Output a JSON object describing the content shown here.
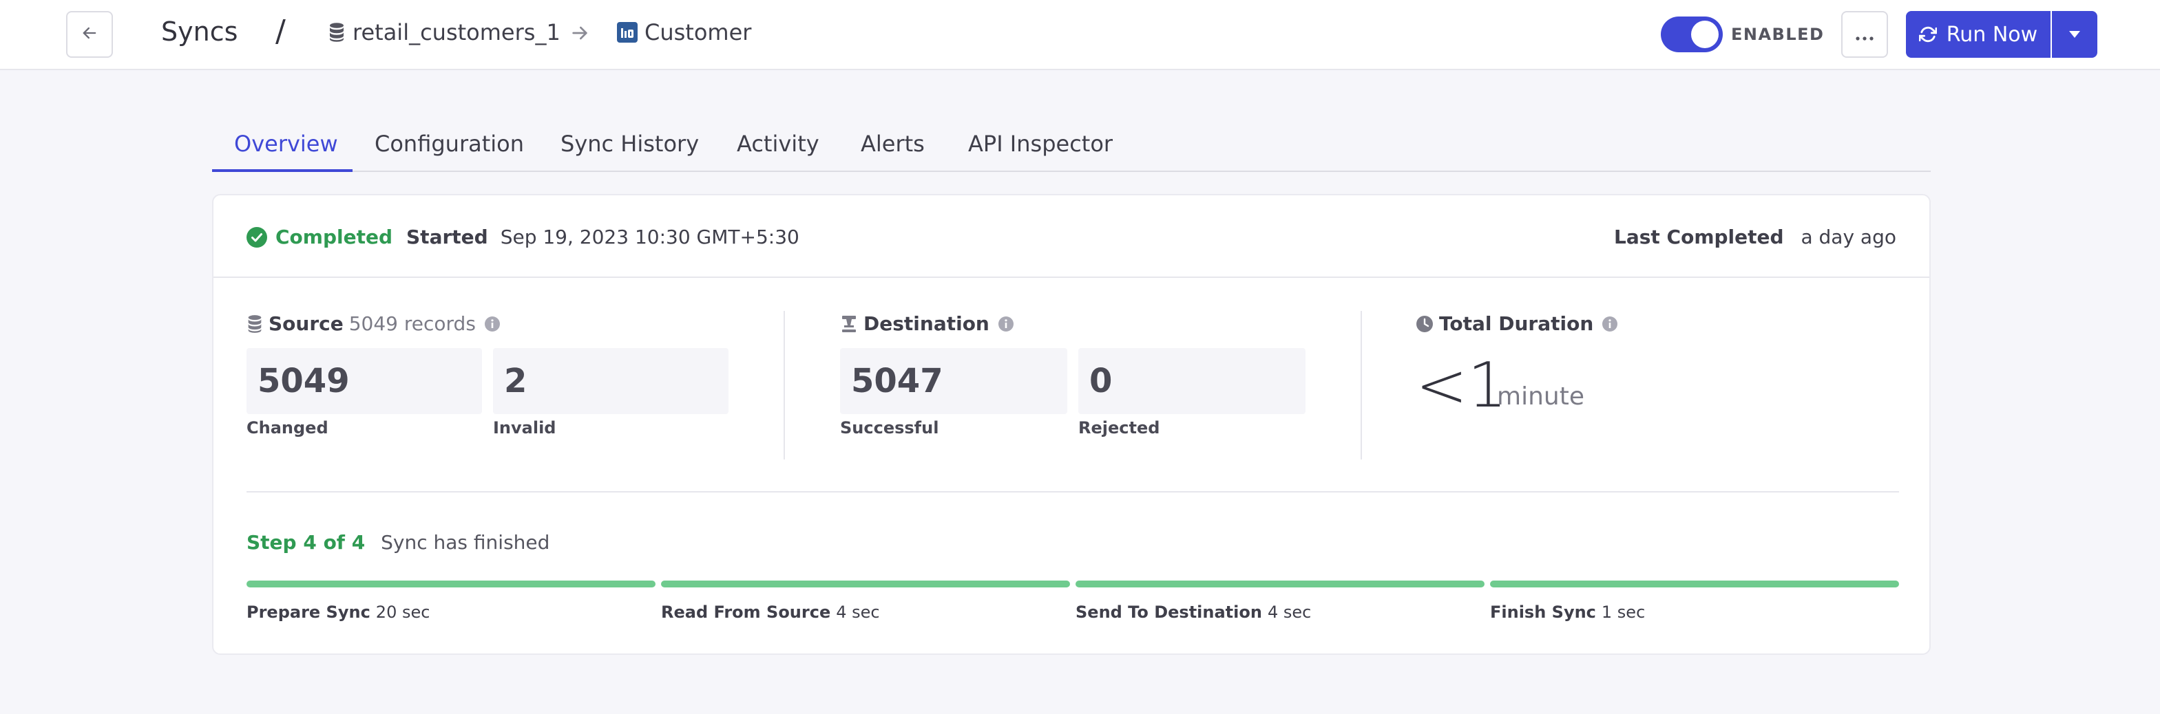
{
  "header": {
    "title": "Syncs",
    "separator": "/",
    "source_name": "retail_customers_1",
    "destination_name": "Customer",
    "toggle_label": "ENABLED",
    "more_label": "···",
    "run_label": "Run Now"
  },
  "tabs": [
    {
      "label": "Overview"
    },
    {
      "label": "Configuration"
    },
    {
      "label": "Sync History"
    },
    {
      "label": "Activity"
    },
    {
      "label": "Alerts"
    },
    {
      "label": "API Inspector"
    }
  ],
  "status": {
    "state": "Completed",
    "started_label": "Started",
    "started_value": "Sep 19, 2023 10:30 GMT+5:30",
    "last_completed_label": "Last Completed",
    "last_completed_value": "a day ago"
  },
  "source": {
    "title": "Source",
    "records": "5049 records",
    "changed_value": "5049",
    "changed_label": "Changed",
    "invalid_value": "2",
    "invalid_label": "Invalid"
  },
  "destination": {
    "title": "Destination",
    "successful_value": "5047",
    "successful_label": "Successful",
    "rejected_value": "0",
    "rejected_label": "Rejected"
  },
  "duration": {
    "title": "Total Duration",
    "value": "<1",
    "unit": "minute"
  },
  "progress": {
    "step": "Step 4 of 4",
    "message": "Sync has finished",
    "steps": [
      {
        "name": "Prepare Sync",
        "time": "20 sec",
        "fraction": 1
      },
      {
        "name": "Read From Source",
        "time": "4 sec",
        "fraction": 1
      },
      {
        "name": "Send To Destination",
        "time": "4 sec",
        "fraction": 1
      },
      {
        "name": "Finish Sync",
        "time": "1 sec",
        "fraction": 1
      }
    ]
  },
  "colors": {
    "accent": "#3f48d6",
    "success": "#2f9a52",
    "progress": "#6fcb8e"
  }
}
